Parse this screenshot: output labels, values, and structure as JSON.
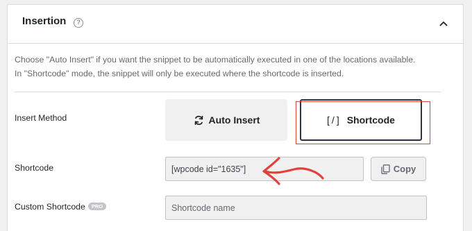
{
  "section": {
    "title": "Insertion",
    "help_icon": "question-circle-icon",
    "collapse_icon": "chevron-up-icon",
    "description_line1": "Choose \"Auto Insert\" if you want the snippet to be automatically executed in one of the locations available.",
    "description_line2": "In \"Shortcode\" mode, the snippet will only be executed where the shortcode is inserted."
  },
  "insert_method": {
    "label": "Insert Method",
    "options": [
      {
        "label": "Auto Insert",
        "icon": "sync-icon",
        "selected": false
      },
      {
        "label": "Shortcode",
        "icon": "shortcode-brackets-icon",
        "icon_text": "[/]",
        "selected": true
      }
    ]
  },
  "shortcode": {
    "label": "Shortcode",
    "value": "[wpcode id=\"1635\"]",
    "copy_label": "Copy",
    "copy_icon": "copy-icon"
  },
  "custom_shortcode": {
    "label": "Custom Shortcode",
    "badge": "PRO",
    "placeholder": "Shortcode name"
  },
  "annotation": {
    "arrow_color": "#e0413a",
    "highlight_color": "#e0413a"
  }
}
